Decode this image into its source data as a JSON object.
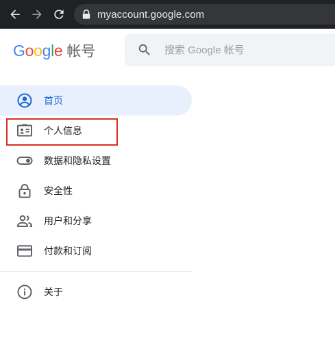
{
  "browser": {
    "url": "myaccount.google.com"
  },
  "header": {
    "logo_letters": [
      {
        "char": "G",
        "color": "#4285F4"
      },
      {
        "char": "o",
        "color": "#EA4335"
      },
      {
        "char": "o",
        "color": "#FBBC05"
      },
      {
        "char": "g",
        "color": "#4285F4"
      },
      {
        "char": "l",
        "color": "#34A853"
      },
      {
        "char": "e",
        "color": "#EA4335"
      }
    ],
    "logo_suffix": "帐号",
    "search_placeholder": "搜索 Google 帐号"
  },
  "sidebar": {
    "items": [
      {
        "label": "首页",
        "icon": "account-circle-icon",
        "active": true
      },
      {
        "label": "个人信息",
        "icon": "id-card-icon",
        "active": false,
        "highlighted": true
      },
      {
        "label": "数据和隐私设置",
        "icon": "toggle-icon",
        "active": false
      },
      {
        "label": "安全性",
        "icon": "lock-icon",
        "active": false
      },
      {
        "label": "用户和分享",
        "icon": "people-icon",
        "active": false
      },
      {
        "label": "付款和订阅",
        "icon": "credit-card-icon",
        "active": false
      }
    ],
    "about": {
      "label": "关于",
      "icon": "info-icon"
    }
  },
  "colors": {
    "active_bg": "#e8f0fe",
    "active_text": "#1967d2",
    "highlight": "#d93025",
    "icon": "#5f6368"
  }
}
